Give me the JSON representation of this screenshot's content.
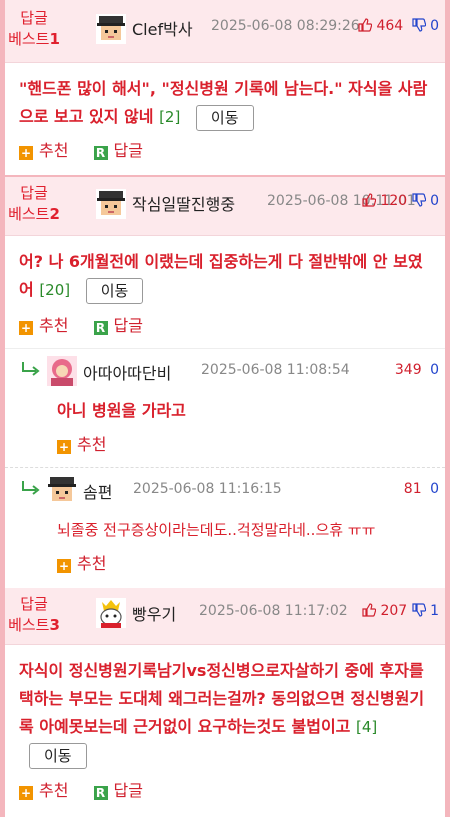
{
  "best1": {
    "label": "답글",
    "badge": "베스트",
    "rank": "1",
    "nickname": "Clef박사",
    "datetime": "2025-06-08 08:29:26",
    "up": "464",
    "down": "0",
    "text": "\"핸드폰 많이 해서\", \"정신병원 기록에 남는다.\" 자식을 사람으로 보고 있지 않네",
    "count": "[2]",
    "move": "이동",
    "recommend": "추천",
    "reply": "답글"
  },
  "best2": {
    "label": "답글",
    "badge": "베스트",
    "rank": "2",
    "nickname": "작심일딸진행중",
    "datetime": "2025-06-08 10:11:01",
    "up": "120",
    "down": "0",
    "text": "어? 나 6개월전에 이랬는데 집중하는게 다 절반밖에 안 보였어",
    "count": "[20]",
    "move": "이동",
    "recommend": "추천",
    "reply": "답글"
  },
  "replies": [
    {
      "nickname": "아따아따단비",
      "datetime": "2025-06-08 11:08:54",
      "up": "349",
      "down": "0",
      "text": "아니 병원을 가라고",
      "recommend": "추천"
    },
    {
      "nickname": "솜편",
      "datetime": "2025-06-08 11:16:15",
      "up": "81",
      "down": "0",
      "text": "뇌졸중 전구증상이라는데도..걱정말라네..으휴 ㅠㅠ",
      "recommend": "추천"
    }
  ],
  "best3": {
    "label": "답글",
    "badge": "베스트",
    "rank": "3",
    "nickname": "빵우기",
    "datetime": "2025-06-08 11:17:02",
    "up": "207",
    "down": "1",
    "text": "자식이 정신병원기록남기vs정신병으로자살하기 중에 후자를 택하는 부모는 도대체 왜그러는걸까? 동의없으면 정신병원기록 아예못보는데 근거없이 요구하는것도 불법이고",
    "count": "[4]",
    "move": "이동",
    "recommend": "추천",
    "reply": "답글"
  },
  "colors": {
    "border": "#f4b6bd",
    "header_bg": "#fde9ec",
    "accent_red": "#d9202c",
    "down_blue": "#2244cc",
    "count_green": "#2a8a2a"
  }
}
